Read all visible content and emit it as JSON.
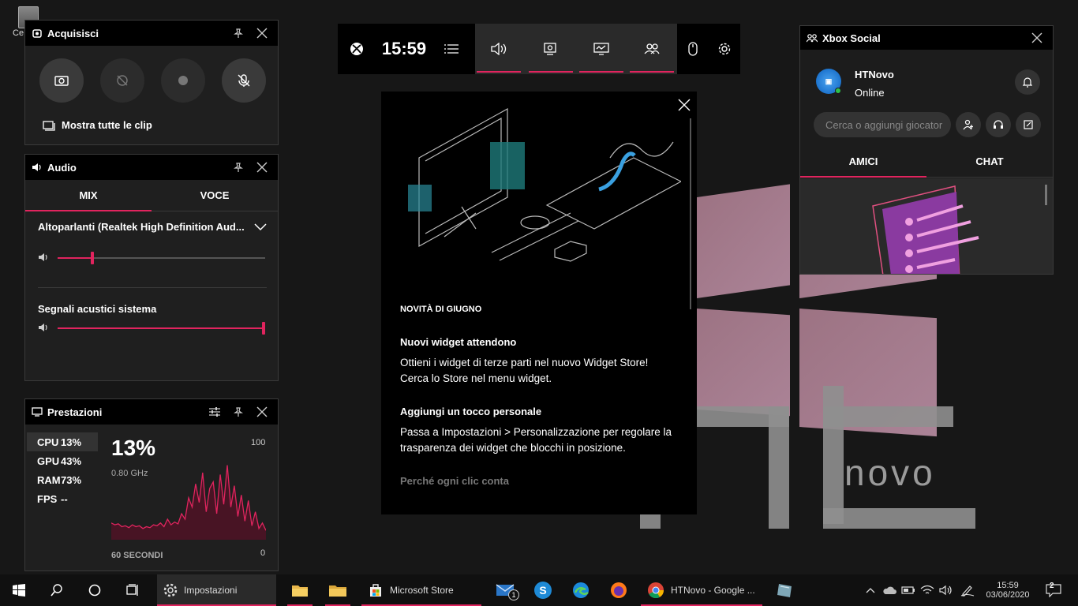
{
  "desktop": {
    "icon_label": "Ce",
    "watermark_text": "novo",
    "accent": "#e0245e"
  },
  "capture": {
    "title": "Acquisisci",
    "show_clips": "Mostra tutte le clip"
  },
  "audio": {
    "title": "Audio",
    "tabs": [
      "MIX",
      "VOCE"
    ],
    "device": "Altoparlanti (Realtek High Definition Aud...",
    "system_sounds": "Segnali acustici sistema",
    "speaker_level": 0.16,
    "system_level": 1.0
  },
  "perf": {
    "title": "Prestazioni",
    "rows": [
      {
        "k": "CPU",
        "v": "13%"
      },
      {
        "k": "GPU",
        "v": "43%"
      },
      {
        "k": "RAM",
        "v": "73%"
      },
      {
        "k": "FPS",
        "v": "--"
      }
    ],
    "big": "13%",
    "freq": "0.80 GHz",
    "max": "100",
    "min": "0",
    "period": "60 SECONDI",
    "cpu_history": [
      18,
      16,
      17,
      14,
      15,
      13,
      16,
      14,
      15,
      12,
      14,
      13,
      16,
      15,
      18,
      14,
      22,
      16,
      19,
      17,
      28,
      22,
      45,
      35,
      60,
      40,
      72,
      30,
      55,
      62,
      28,
      70,
      38,
      80,
      35,
      58,
      25,
      48,
      20,
      42,
      15,
      30,
      12,
      18,
      10
    ]
  },
  "gamebar": {
    "time": "15:59"
  },
  "news": {
    "kicker": "NOVITÀ DI GIUGNO",
    "h1": "Nuovi widget attendono",
    "p1": "Ottieni i widget di terze parti nel nuovo Widget Store! Cerca lo Store nel menu widget.",
    "h2": "Aggiungi un tocco personale",
    "p2": "Passa a Impostazioni > Personalizzazione per regolare la trasparenza dei widget che blocchi in posizione.",
    "h3": "Perché ogni clic conta"
  },
  "social": {
    "title": "Xbox Social",
    "user": "HTNovo",
    "status": "Online",
    "search_placeholder": "Cerca o aggiungi giocator",
    "tabs": [
      "AMICI",
      "CHAT"
    ]
  },
  "taskbar": {
    "settings": "Impostazioni",
    "store": "Microsoft Store",
    "chrome": "HTNovo - Google ...",
    "mail_badge": "1",
    "clock_time": "15:59",
    "clock_date": "03/06/2020",
    "notif_count": "2"
  }
}
